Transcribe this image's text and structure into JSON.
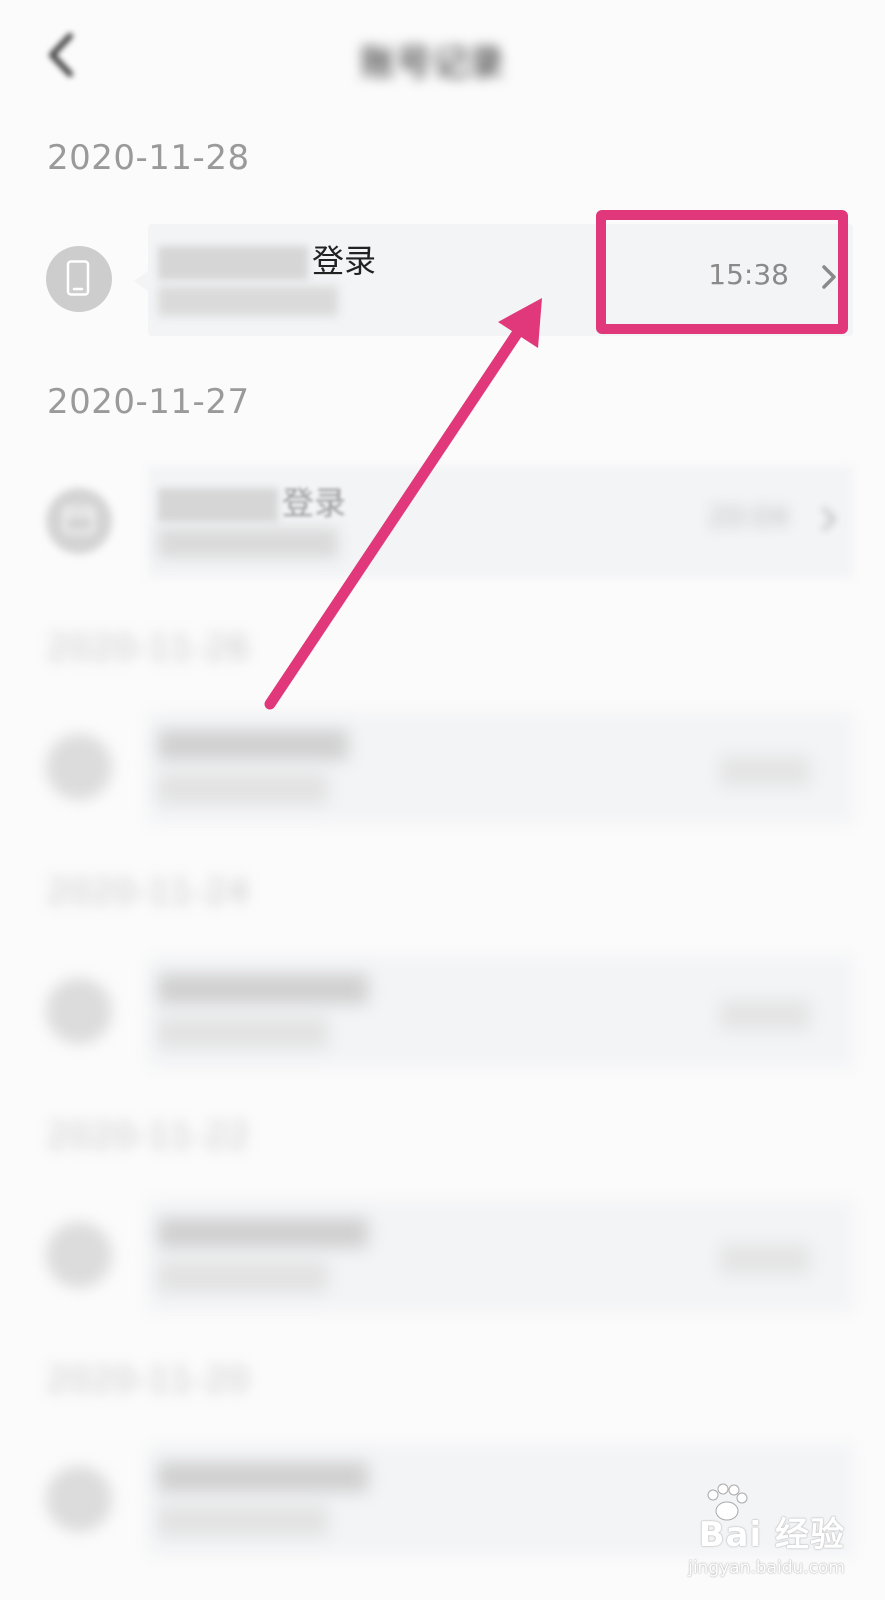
{
  "header": {
    "title": "账号记录",
    "back_icon": "chevron-left-icon"
  },
  "groups": [
    {
      "date": "2020-11-28",
      "title_suffix": "登录",
      "time": "15:38",
      "icon": "phone-icon"
    },
    {
      "date": "2020-11-27",
      "title_suffix": "登录",
      "time": "20:04",
      "icon": "browser-icon"
    },
    {
      "date": "2020-11-26",
      "title_suffix": "",
      "time": "",
      "icon": ""
    },
    {
      "date": "2020-11-24",
      "title_suffix": "",
      "time": "",
      "icon": ""
    },
    {
      "date": "2020-11-22",
      "title_suffix": "",
      "time": "",
      "icon": ""
    },
    {
      "date": "2020-11-20",
      "title_suffix": "",
      "time": "",
      "icon": ""
    }
  ],
  "annotation": {
    "highlight_color": "#e0387a"
  },
  "colors": {
    "background": "#fbfbfb",
    "card": "#f3f4f6",
    "avatar": "#cdcdcd",
    "date_text": "#9a9a9a"
  },
  "watermark": {
    "logo": "Bai 经验",
    "url": "jingyan.baidu.com"
  }
}
